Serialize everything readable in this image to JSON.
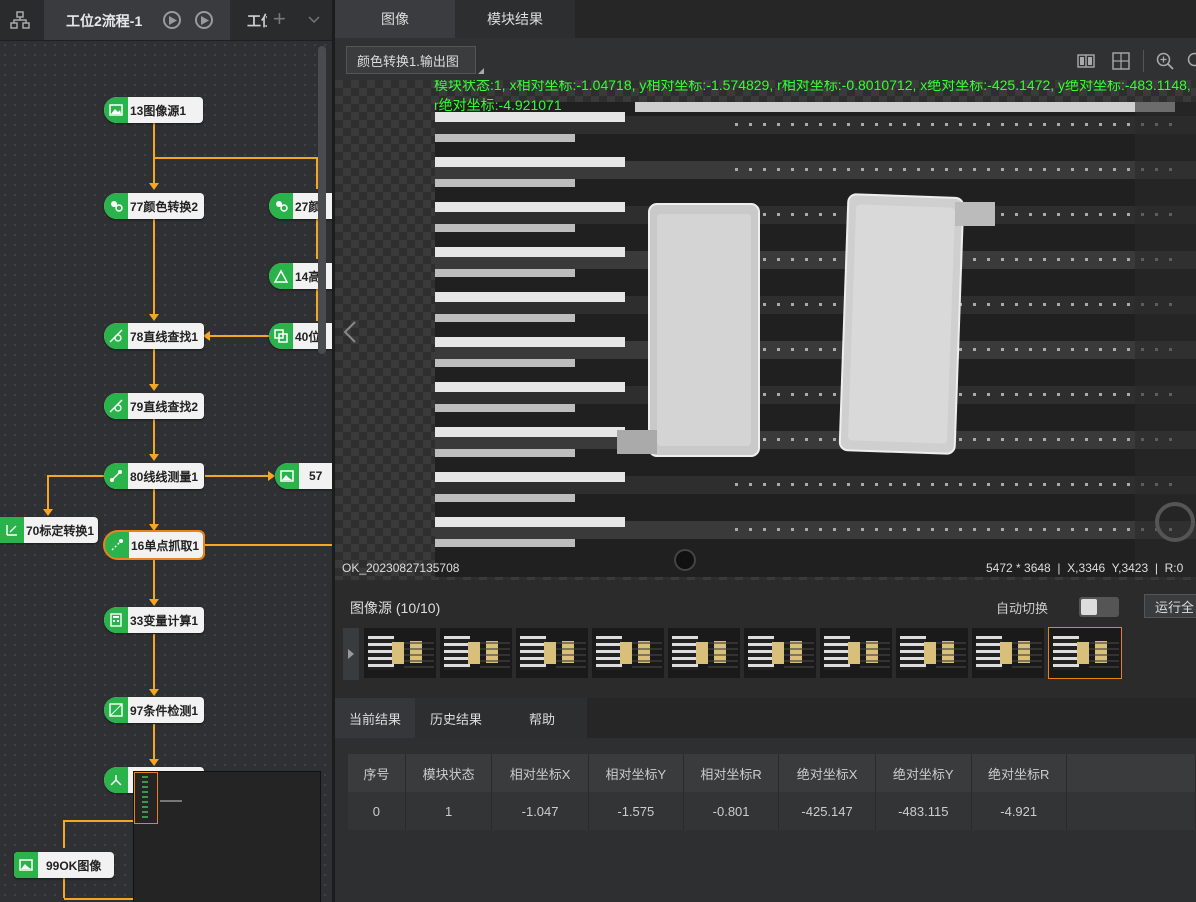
{
  "flow_tabs": {
    "active": "工位2流程-1",
    "second": "工位"
  },
  "nodes": {
    "n13": "13图像源1",
    "n77": "77颜色转换2",
    "n27": "27颜",
    "n14": "14高",
    "n78": "78直线查找1",
    "n40": "40位",
    "n79": "79直线查找2",
    "n80": "80线线测量1",
    "n57": "57",
    "n70": "70标定转换1",
    "n16": "16单点抓取1",
    "n33": "33变量计算1",
    "n97": "97条件检测1",
    "n99": "99OK图像"
  },
  "tabs": {
    "image": "图像",
    "module_result": "模块结果"
  },
  "image_source_select": "颜色转换1.输出图",
  "overlay_text": "模块状态:1, x相对坐标:-1.04718, y相对坐标:-1.574829, r相对坐标:-0.8010712, x绝对坐标:-425.1472, y绝对坐标:-483.1148, r绝对坐标:-4.921071",
  "filename": "OK_20230827135708",
  "image_info": "5472 * 3648  |  X,3346  Y,3423  |  R:0",
  "filmstrip": {
    "title": "图像源 (10/10)",
    "auto_switch": "自动切换",
    "run_all": "运行全",
    "count": 10,
    "selected_index": 9
  },
  "result_tabs": {
    "current": "当前结果",
    "history": "历史结果",
    "help": "帮助"
  },
  "table": {
    "headers": [
      "序号",
      "模块状态",
      "相对坐标X",
      "相对坐标Y",
      "相对坐标R",
      "绝对坐标X",
      "绝对坐标Y",
      "绝对坐标R"
    ],
    "rows": [
      [
        "0",
        "1",
        "-1.047",
        "-1.575",
        "-0.801",
        "-425.147",
        "-483.115",
        "-4.921"
      ]
    ]
  },
  "colors": {
    "accent": "#f5a623",
    "node_icon": "#29b34a",
    "overlay": "#33ff33",
    "selected": "#e8831c"
  },
  "icons": [
    "flowchart-icon",
    "play-icon",
    "loop-run-icon",
    "plus-icon",
    "chevron-down-icon",
    "split-view-icon",
    "grid-view-icon",
    "zoom-in-icon",
    "prev-arrow-icon"
  ]
}
